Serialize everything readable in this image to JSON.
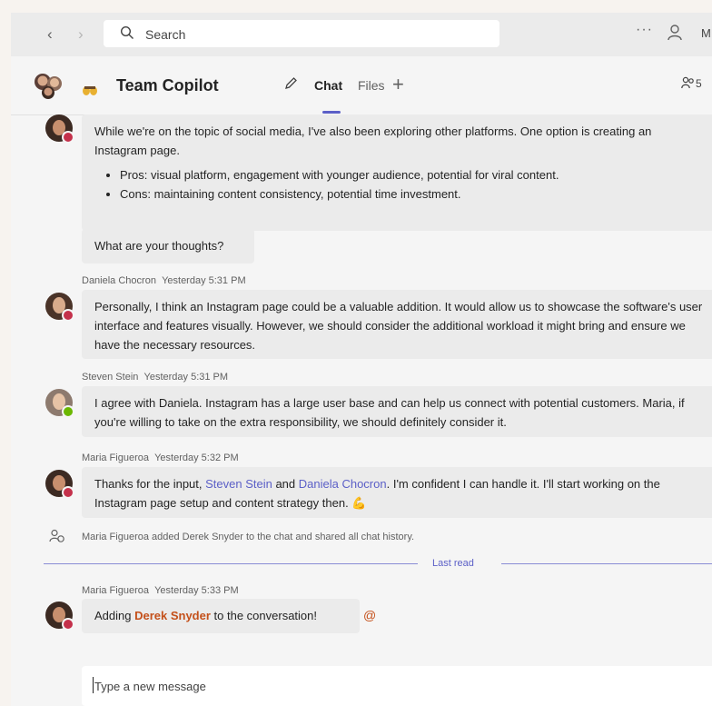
{
  "topbar": {
    "back_icon": "chevron-left-icon",
    "forward_icon": "chevron-right-icon",
    "search_placeholder": "Search",
    "more_label": "···",
    "profile_initial": "M"
  },
  "header": {
    "title": "Team Copilot",
    "tabs": [
      {
        "label": "Chat",
        "active": true
      },
      {
        "label": "Files",
        "active": false
      }
    ],
    "add_tab": "+",
    "participants_count": "5"
  },
  "messages": [
    {
      "author": "",
      "time": "",
      "text": "While we're on the topic of social media, I've also been exploring other platforms. One option is creating an Instagram page.",
      "bullets": [
        "Pros: visual platform, engagement with younger audience, potential for viral content.",
        "Cons: maintaining content consistency, potential time investment."
      ],
      "followup": "What are your thoughts?"
    },
    {
      "author": "Daniela Chocron",
      "time": "Yesterday 5:31 PM",
      "text": "Personally, I think an Instagram page could be a valuable addition. It would allow us to showcase the software's user interface and features visually. However, we should consider the additional workload it might bring and ensure we have the necessary resources."
    },
    {
      "author": "Steven Stein",
      "time": "Yesterday 5:31 PM",
      "text": "I agree with Daniela. Instagram has a large user base and can help us connect with potential customers. Maria, if you're willing to take on the extra responsibility, we should definitely consider it."
    },
    {
      "author": "Maria Figueroa",
      "time": "Yesterday 5:32 PM",
      "text_before": "Thanks for the input, ",
      "mention1": "Steven Stein",
      "text_mid": " and ",
      "mention2": "Daniela Chocron",
      "text_after": ". I'm confident I can handle it. I'll start working on the Instagram page setup and content strategy then. ",
      "emoji": "💪"
    }
  ],
  "system_message": "Maria Figueroa added Derek Snyder to the chat and shared all chat history.",
  "last_read": "Last read",
  "last_message": {
    "author": "Maria Figueroa",
    "time": "Yesterday 5:33 PM",
    "text_before": "Adding ",
    "mention": "Derek Snyder",
    "text_after": " to the conversation!",
    "at_symbol": "@"
  },
  "compose": {
    "placeholder": "Type a new message"
  },
  "colors": {
    "accent": "#5b5fc7",
    "mention_highlight": "#c4501a",
    "presence_busy": "#c4314b",
    "presence_available": "#6bb700"
  }
}
